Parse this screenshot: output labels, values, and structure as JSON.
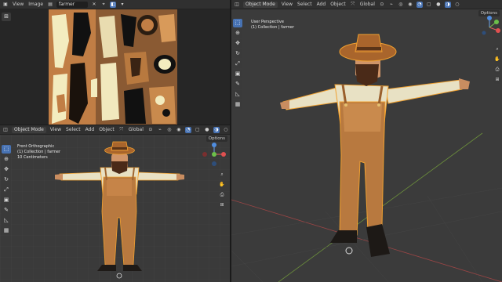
{
  "uv_editor": {
    "menus": [
      "View",
      "Image"
    ],
    "image_name": "farmer"
  },
  "front_view": {
    "mode": "Object Mode",
    "menus": [
      "View",
      "Select",
      "Add",
      "Object"
    ],
    "transform": "Global",
    "options_label": "Options",
    "overlay": [
      "Front Orthographic",
      "(1) Collection | farmer",
      "10 Centimeters"
    ]
  },
  "persp_view": {
    "mode": "Object Mode",
    "menus": [
      "View",
      "Select",
      "Add",
      "Object"
    ],
    "transform": "Global",
    "options_label": "Options",
    "overlay": [
      "User Perspective",
      "(1) Collection | farmer"
    ]
  },
  "icons": [
    "select-box",
    "cursor",
    "move",
    "rotate",
    "scale",
    "transform",
    "annotate",
    "measure",
    "add-cube",
    "zoom",
    "hand",
    "camera",
    "grid"
  ],
  "colors": {
    "active_blue": "#4772b3",
    "skin_brown": "#b8793f",
    "shirt_cream": "#e9e2c5",
    "hat_brown": "#a9652c",
    "outline_orange": "#f0a030"
  }
}
